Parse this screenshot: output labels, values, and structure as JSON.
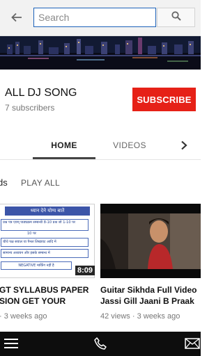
{
  "search": {
    "placeholder": "Search",
    "value": ""
  },
  "channel": {
    "name": "ALL DJ SONG",
    "subscribers": "7 subscribers",
    "subscribe_label": "SUBSCRIBE"
  },
  "tabs": [
    {
      "label": "HOME",
      "active": true
    },
    {
      "label": "VIDEOS",
      "active": false
    }
  ],
  "section": {
    "title": "ds",
    "play_all": "PLAY ALL"
  },
  "videos": [
    {
      "title_line1": "GT SYLLABUS PAPER",
      "title_line2": "SION GET YOUR",
      "meta": "· 3 weeks ago",
      "duration": "8:09",
      "thumb_heading": "ध्यान देने योग्य बातें",
      "thumb_lines": [
        "प्रश्न पत्र एवम् पाठ्यक्रम सम्बन्धी 8-10 प्रश्न जो 1-10 पर",
        "10 पर",
        "चौथे पक्ष सवाल या पैनल लिखावट आदि में",
        "सामान्य अध्ययन और इसके सम्बन्ध में",
        "NEGATIVE मार्किंग नहीं है"
      ]
    },
    {
      "title_line1": "Guitar Sikhda Full Video",
      "title_line2": "Jassi Gill Jaani B Praak",
      "meta": "42 views · 3 weeks ago"
    }
  ],
  "icons": {
    "back": "back-arrow-icon",
    "search": "search-icon",
    "tab_next": "chevron-right-icon",
    "menu": "menu-icon",
    "phone": "phone-icon",
    "mail": "mail-icon"
  },
  "colors": {
    "subscribe": "#e62117",
    "search_border": "#1c62b9",
    "bottom_bar": "#0d0d0d"
  }
}
